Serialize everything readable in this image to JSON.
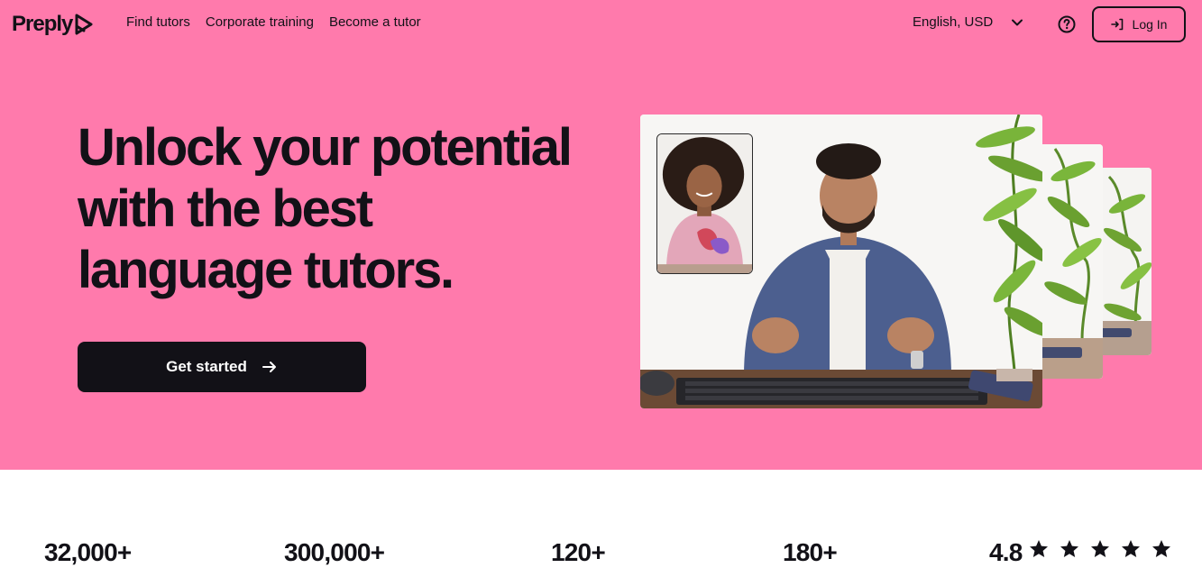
{
  "brand": {
    "name": "Preply",
    "logo_icon": "preply-logo-icon"
  },
  "nav": {
    "links": [
      "Find tutors",
      "Corporate training",
      "Become a tutor"
    ],
    "language": "English, USD",
    "help_icon": "question-circle-icon",
    "login_label": "Log In"
  },
  "hero": {
    "headline_lines": [
      "Unlock your potential",
      "with the best",
      "language tutors."
    ],
    "cta_label": "Get started",
    "background_color": "#ff7aac",
    "button_color": "#121117"
  },
  "stats": {
    "values": [
      "32,000+",
      "300,000+",
      "120+",
      "180+",
      "4.8"
    ],
    "rating_stars": 5
  }
}
